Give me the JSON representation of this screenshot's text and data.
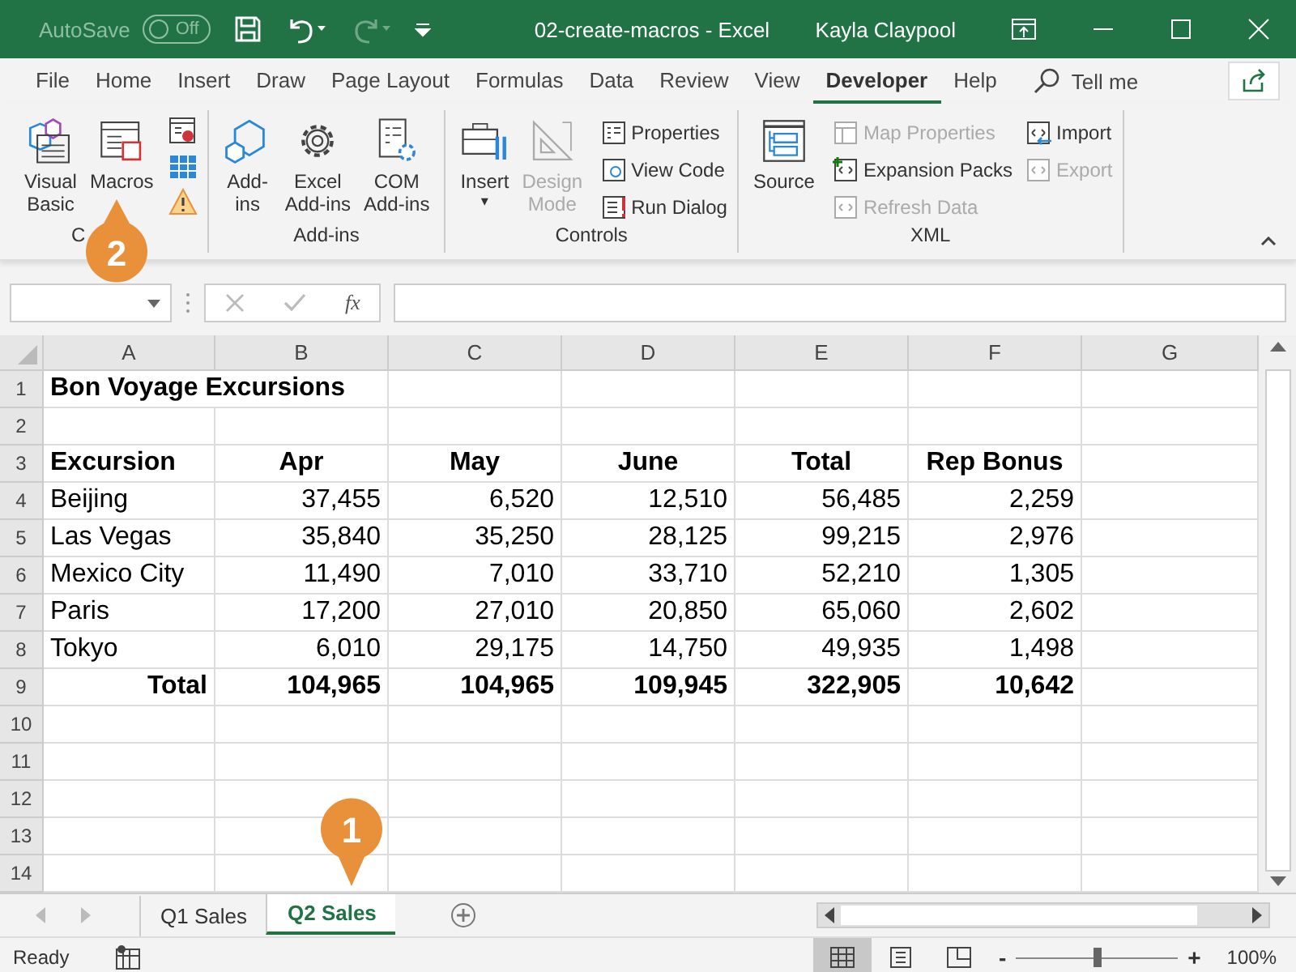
{
  "title_bar": {
    "autosave_label": "AutoSave",
    "autosave_toggle": {
      "label": "Off",
      "on": false
    },
    "title": "02-create-macros  -  Excel",
    "user": "Kayla Claypool"
  },
  "ribbon_tabs": [
    {
      "label": "File",
      "selected": false
    },
    {
      "label": "Home",
      "selected": false
    },
    {
      "label": "Insert",
      "selected": false
    },
    {
      "label": "Draw",
      "selected": false
    },
    {
      "label": "Page Layout",
      "selected": false
    },
    {
      "label": "Formulas",
      "selected": false
    },
    {
      "label": "Data",
      "selected": false
    },
    {
      "label": "Review",
      "selected": false
    },
    {
      "label": "View",
      "selected": false
    },
    {
      "label": "Developer",
      "selected": true
    },
    {
      "label": "Help",
      "selected": false
    }
  ],
  "tell_me": {
    "placeholder": "Tell me"
  },
  "ribbon_groups": [
    {
      "label": "C",
      "big": [
        {
          "lines": [
            "Visual",
            "Basic"
          ],
          "disabled": false
        },
        {
          "lines": [
            "Macros"
          ],
          "disabled": false
        }
      ]
    },
    {
      "label": "Add-ins",
      "big": [
        {
          "lines": [
            "Add-",
            "ins"
          ],
          "disabled": false
        },
        {
          "lines": [
            "Excel",
            "Add-ins"
          ],
          "disabled": false
        },
        {
          "lines": [
            "COM",
            "Add-ins"
          ],
          "disabled": false
        }
      ]
    },
    {
      "label": "Controls",
      "big": [
        {
          "lines": [
            "Insert"
          ],
          "disabled": false,
          "caret": "▾"
        },
        {
          "lines": [
            "Design",
            "Mode"
          ],
          "disabled": true
        }
      ],
      "small": [
        [
          {
            "label": "Properties",
            "disabled": false
          },
          {
            "label": "View Code",
            "disabled": false
          },
          {
            "label": "Run Dialog",
            "disabled": false
          }
        ]
      ]
    },
    {
      "label": "XML",
      "big": [
        {
          "lines": [
            "Source"
          ],
          "disabled": false
        }
      ],
      "small": [
        [
          {
            "label": "Map Properties",
            "disabled": true
          },
          {
            "label": "Expansion Packs",
            "disabled": false
          },
          {
            "label": "Refresh Data",
            "disabled": true
          }
        ],
        [
          {
            "label": "Import",
            "disabled": false
          },
          {
            "label": "Export",
            "disabled": true
          }
        ]
      ]
    }
  ],
  "formula_bar": {
    "function_label": "fx"
  },
  "columns": [
    "A",
    "B",
    "C",
    "D",
    "E",
    "F",
    "G"
  ],
  "rows": [
    {
      "number": "1",
      "kind": "title",
      "cells": [
        "Bon Voyage Excursions"
      ]
    },
    {
      "number": "2",
      "kind": "data",
      "cells": []
    },
    {
      "number": "3",
      "kind": "header",
      "cells": [
        "Excursion",
        "Apr",
        "May",
        "June",
        "Total",
        "Rep Bonus"
      ]
    },
    {
      "number": "4",
      "kind": "data",
      "cells": [
        "Beijing",
        "37,455",
        "6,520",
        "12,510",
        "56,485",
        "2,259"
      ]
    },
    {
      "number": "5",
      "kind": "data",
      "cells": [
        "Las Vegas",
        "35,840",
        "35,250",
        "28,125",
        "99,215",
        "2,976"
      ]
    },
    {
      "number": "6",
      "kind": "data",
      "cells": [
        "Mexico City",
        "11,490",
        "7,010",
        "33,710",
        "52,210",
        "1,305"
      ]
    },
    {
      "number": "7",
      "kind": "data",
      "cells": [
        "Paris",
        "17,200",
        "27,010",
        "20,850",
        "65,060",
        "2,602"
      ]
    },
    {
      "number": "8",
      "kind": "data",
      "cells": [
        "Tokyo",
        "6,010",
        "29,175",
        "14,750",
        "49,935",
        "1,498"
      ]
    },
    {
      "number": "9",
      "kind": "total",
      "cells": [
        "Total",
        "104,965",
        "104,965",
        "109,945",
        "322,905",
        "10,642"
      ]
    },
    {
      "number": "10",
      "kind": "data",
      "cells": []
    },
    {
      "number": "11",
      "kind": "data",
      "cells": []
    },
    {
      "number": "12",
      "kind": "data",
      "cells": []
    },
    {
      "number": "13",
      "kind": "data",
      "cells": []
    },
    {
      "number": "14",
      "kind": "data",
      "cells": []
    }
  ],
  "sheet_tabs": [
    {
      "label": "Q1 Sales",
      "selected": false
    },
    {
      "label": "Q2 Sales",
      "selected": true
    }
  ],
  "status_bar": {
    "status": "Ready",
    "views": [
      {
        "selected": true
      },
      {
        "selected": false
      },
      {
        "selected": false
      }
    ],
    "zoom": {
      "level": 0.5,
      "minus": "-",
      "plus": "+",
      "reading": "100%"
    }
  },
  "callouts": [
    {
      "number": "2",
      "kind": "pointer_up"
    },
    {
      "number": "1",
      "kind": "pointer_down"
    }
  ]
}
